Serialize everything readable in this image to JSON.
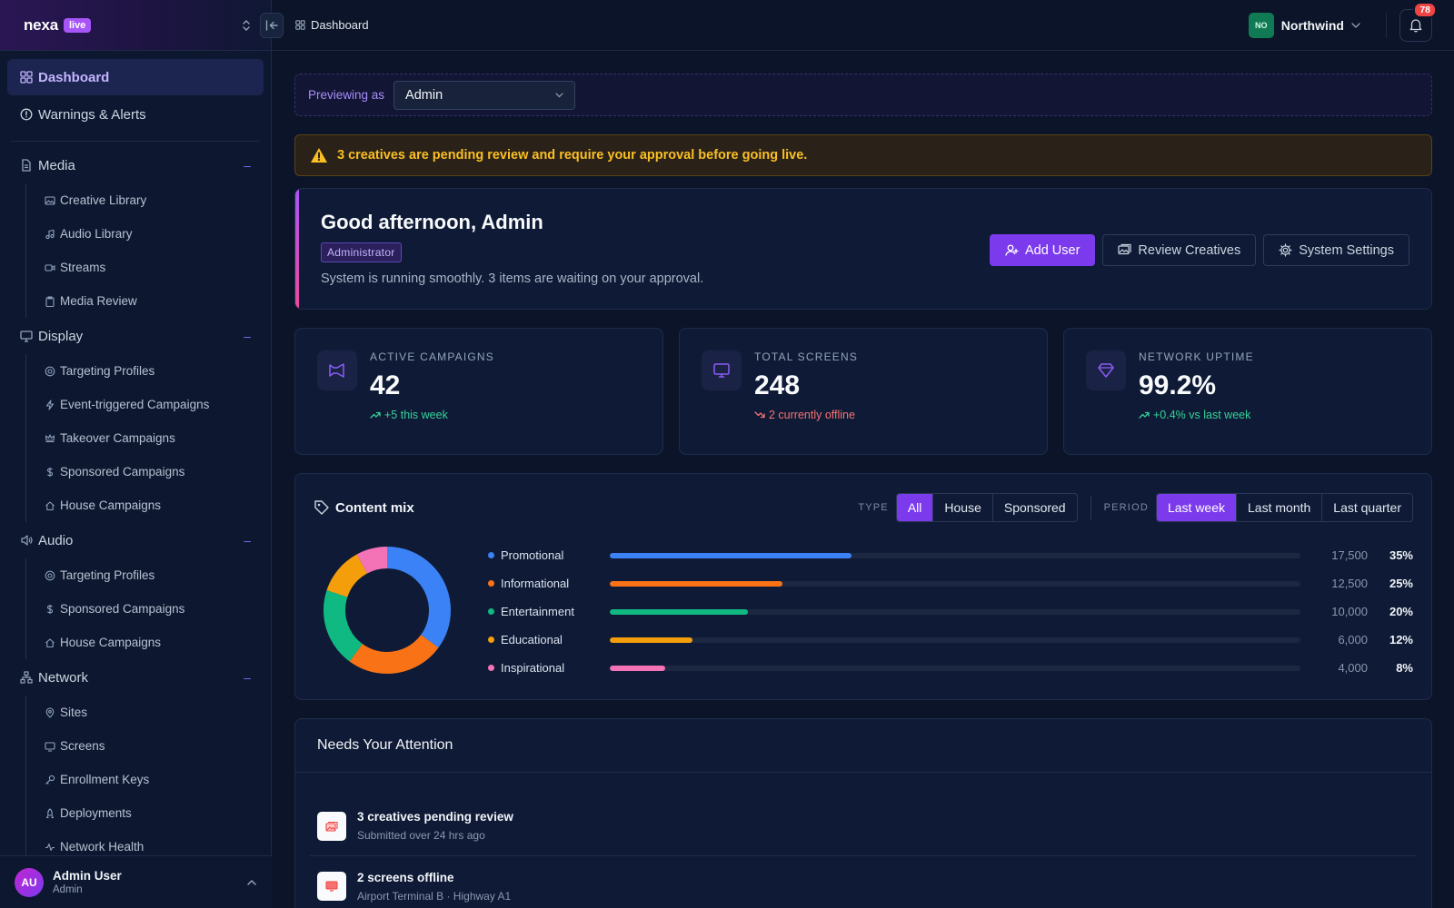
{
  "brand": {
    "name": "nexa",
    "badge": "live"
  },
  "sidebar": {
    "top": [
      {
        "label": "Dashboard",
        "icon": "grid-icon",
        "active": true
      },
      {
        "label": "Warnings & Alerts",
        "icon": "alert-circle-icon",
        "active": false
      }
    ],
    "sections": [
      {
        "label": "Media",
        "icon": "file-icon",
        "items": [
          {
            "label": "Creative Library",
            "icon": "images-icon"
          },
          {
            "label": "Audio Library",
            "icon": "music-note-icon"
          },
          {
            "label": "Streams",
            "icon": "video-icon"
          },
          {
            "label": "Media Review",
            "icon": "clipboard-icon"
          }
        ]
      },
      {
        "label": "Display",
        "icon": "monitor-icon",
        "items": [
          {
            "label": "Targeting Profiles",
            "icon": "target-icon"
          },
          {
            "label": "Event-triggered Campaigns",
            "icon": "bolt-icon"
          },
          {
            "label": "Takeover Campaigns",
            "icon": "crown-icon"
          },
          {
            "label": "Sponsored Campaigns",
            "icon": "dollar-icon"
          },
          {
            "label": "House Campaigns",
            "icon": "home-icon"
          }
        ]
      },
      {
        "label": "Audio",
        "icon": "speaker-icon",
        "items": [
          {
            "label": "Targeting Profiles",
            "icon": "target-icon"
          },
          {
            "label": "Sponsored Campaigns",
            "icon": "dollar-icon"
          },
          {
            "label": "House Campaigns",
            "icon": "home-icon"
          }
        ]
      },
      {
        "label": "Network",
        "icon": "network-icon",
        "items": [
          {
            "label": "Sites",
            "icon": "map-pin-icon"
          },
          {
            "label": "Screens",
            "icon": "screen-icon"
          },
          {
            "label": "Enrollment Keys",
            "icon": "key-icon"
          },
          {
            "label": "Deployments",
            "icon": "rocket-icon"
          },
          {
            "label": "Network Health",
            "icon": "activity-icon"
          }
        ]
      }
    ],
    "collapse_glyph": "–"
  },
  "user": {
    "initials": "AU",
    "name": "Admin User",
    "role": "Admin"
  },
  "topbar": {
    "breadcrumb": "Dashboard",
    "org": {
      "initials": "NO",
      "name": "Northwind"
    },
    "notifications": "78"
  },
  "preview": {
    "label": "Previewing as",
    "selected": "Admin"
  },
  "alert": {
    "text": "3 creatives are pending review and require your approval before going live."
  },
  "greeting": {
    "title": "Good afternoon, Admin",
    "role": "Administrator",
    "message": "System is running smoothly. 3 items are waiting on your approval.",
    "actions": {
      "add_user": "Add User",
      "review": "Review Creatives",
      "settings": "System Settings"
    }
  },
  "stats": [
    {
      "label": "Active Campaigns",
      "value": "42",
      "delta": "+5 this week",
      "trend": "up",
      "icon": "megaphone-icon"
    },
    {
      "label": "Total Screens",
      "value": "248",
      "delta": "2 currently offline",
      "trend": "down",
      "icon": "monitor-icon"
    },
    {
      "label": "Network Uptime",
      "value": "99.2%",
      "delta": "+0.4% vs last week",
      "trend": "up",
      "icon": "diamond-icon"
    }
  ],
  "content_mix": {
    "title": "Content mix",
    "type_label": "TYPE",
    "type_options": [
      "All",
      "House",
      "Sponsored"
    ],
    "type_selected": "All",
    "period_label": "PERIOD",
    "period_options": [
      "Last week",
      "Last month",
      "Last quarter"
    ],
    "period_selected": "Last week"
  },
  "chart_data": {
    "type": "pie",
    "categories": [
      "Promotional",
      "Informational",
      "Entertainment",
      "Educational",
      "Inspirational"
    ],
    "values": [
      17500,
      12500,
      10000,
      6000,
      4000
    ],
    "value_labels": [
      "17,500",
      "12,500",
      "10,000",
      "6,000",
      "4,000"
    ],
    "percent_labels": [
      "35%",
      "25%",
      "20%",
      "12%",
      "8%"
    ],
    "percents": [
      35,
      25,
      20,
      12,
      8
    ],
    "colors": [
      "#3b82f6",
      "#f97316",
      "#10b981",
      "#f59e0b",
      "#f472b6"
    ],
    "bar_max_percent": 100
  },
  "attention": {
    "title": "Needs Your Attention",
    "items": [
      {
        "title": "3 creatives pending review",
        "sub": "Submitted over 24 hrs ago",
        "icon": "images-icon"
      },
      {
        "title": "2 screens offline",
        "sub": "Airport Terminal B · Highway A1",
        "icon": "screen-icon"
      }
    ]
  }
}
